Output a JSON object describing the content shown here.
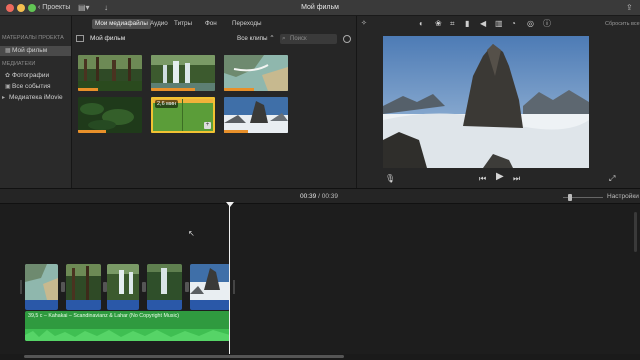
{
  "titlebar": {
    "back_label": "Проекты",
    "window_title": "Мой фильм"
  },
  "sidebar": {
    "section_project": "МАТЕРИАЛЫ ПРОЕКТА",
    "project_item": "Мой фильм",
    "section_libraries": "МЕДИАТЕКИ",
    "items": [
      {
        "label": "Фотографии"
      },
      {
        "label": "Все события"
      },
      {
        "label": "Медиатека iMovie"
      }
    ]
  },
  "browser": {
    "tabs": [
      {
        "label": "Мои медиафайлы"
      },
      {
        "label": "Аудио"
      },
      {
        "label": "Титры"
      },
      {
        "label": "Фон"
      },
      {
        "label": "Переходы"
      }
    ],
    "title": "Мой фильм",
    "clips_dropdown": "Все клипы",
    "search_placeholder": "Поиск",
    "selected_clip_duration": "2,6 мин"
  },
  "viewer": {
    "reset_label": "Сбросить все"
  },
  "timeline": {
    "current_time": "00:39",
    "separator": "/",
    "total_time": "00:39",
    "settings_label": "Настройки",
    "audio_clip_label": "39,5 с – Kahakai – Scandinavianz & Lahar (No Copyright Music)"
  },
  "colors": {
    "accent_yellow": "#f1c232",
    "clip_blue": "#2a58a8",
    "audio_green": "#2f9a3f",
    "used_orange": "#e8902a"
  }
}
